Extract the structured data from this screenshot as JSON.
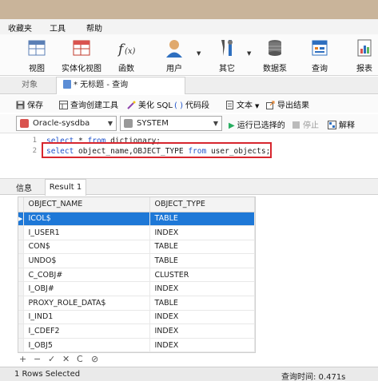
{
  "menu": [
    "收藏夹",
    "工具",
    "帮助"
  ],
  "ribbon": [
    {
      "label": "视图",
      "icon": "view-icon"
    },
    {
      "label": "实体化视图",
      "icon": "materialized-view-icon"
    },
    {
      "label": "函数",
      "icon": "function-icon"
    },
    {
      "label": "用户",
      "icon": "user-icon"
    },
    {
      "label": "其它",
      "icon": "tools-icon"
    },
    {
      "label": "数据泵",
      "icon": "data-pump-icon"
    },
    {
      "label": "查询",
      "icon": "query-icon"
    },
    {
      "label": "报表",
      "icon": "report-icon"
    }
  ],
  "tabs": {
    "objects": "对象",
    "query": "* 无标题 - 查询"
  },
  "toolbar": {
    "save": "保存",
    "query_builder": "查询创建工具",
    "beautify": "美化 SQL",
    "snippet": "代码段",
    "text": "文本",
    "export": "导出结果"
  },
  "connection": {
    "name": "Oracle-sysdba",
    "schema": "SYSTEM"
  },
  "actions": {
    "run_selected": "运行已选择的",
    "stop": "停止",
    "explain": "解释"
  },
  "editor": {
    "lines": [
      {
        "num": "1",
        "kw1": "select",
        "t1": " * ",
        "kw2": "from",
        "t2": " dictionary;"
      },
      {
        "num": "2",
        "kw1": "select",
        "t1": " object_name,OBJECT_TYPE ",
        "kw2": "from",
        "t2": " user_objects;"
      }
    ]
  },
  "result_tabs": {
    "info": "信息",
    "result": "Result 1"
  },
  "grid": {
    "columns": [
      "OBJECT_NAME",
      "OBJECT_TYPE"
    ],
    "rows": [
      [
        "ICOL$",
        "TABLE"
      ],
      [
        "I_USER1",
        "INDEX"
      ],
      [
        "CON$",
        "TABLE"
      ],
      [
        "UNDO$",
        "TABLE"
      ],
      [
        "C_COBJ#",
        "CLUSTER"
      ],
      [
        "I_OBJ#",
        "INDEX"
      ],
      [
        "PROXY_ROLE_DATA$",
        "TABLE"
      ],
      [
        "I_IND1",
        "INDEX"
      ],
      [
        "I_CDEF2",
        "INDEX"
      ],
      [
        "I_OBJ5",
        "INDEX"
      ]
    ],
    "selected_row": 0
  },
  "grid_nav": [
    "+",
    "−",
    "✓",
    "✕",
    "C",
    "⊘"
  ],
  "status": {
    "rows": "1 Rows Selected",
    "time": "查询时间: 0.471s"
  },
  "colors": {
    "selection": "#1e78d7",
    "highlight_box": "#d7262e",
    "keyword": "#2255cc"
  }
}
